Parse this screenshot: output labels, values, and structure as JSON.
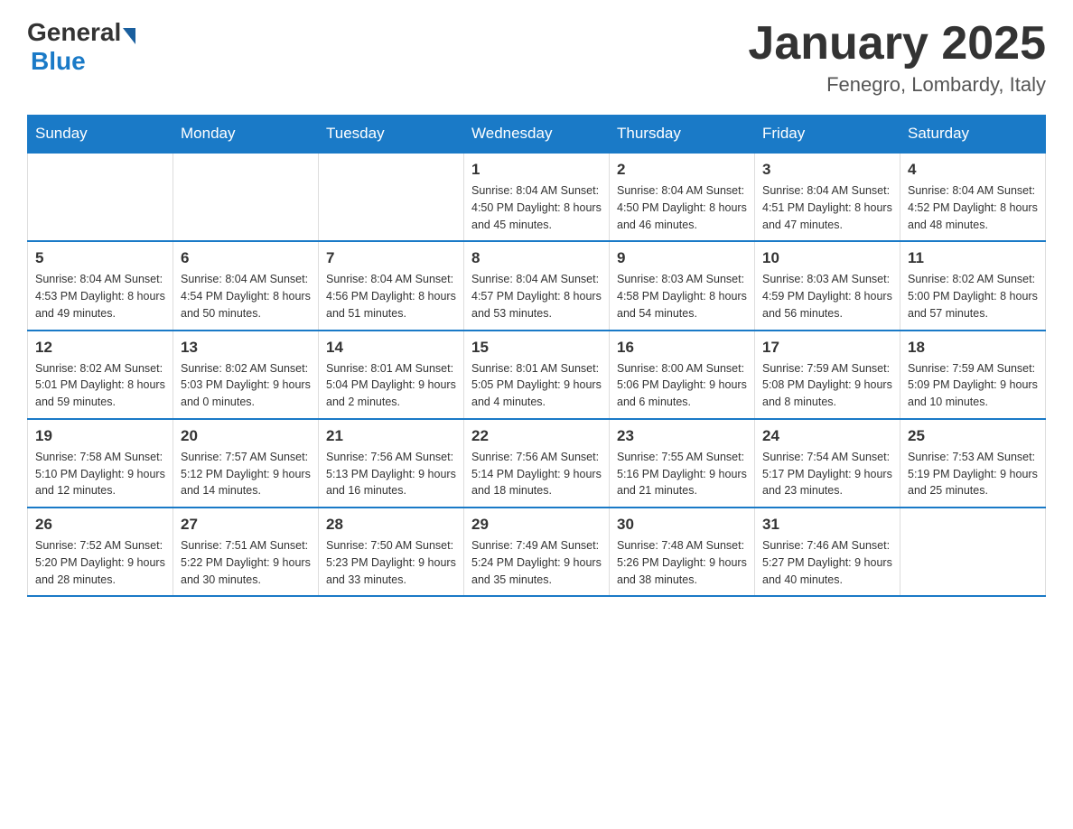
{
  "header": {
    "logo": {
      "general": "General",
      "blue": "Blue"
    },
    "title": "January 2025",
    "location": "Fenegro, Lombardy, Italy"
  },
  "days_of_week": [
    "Sunday",
    "Monday",
    "Tuesday",
    "Wednesday",
    "Thursday",
    "Friday",
    "Saturday"
  ],
  "weeks": [
    [
      {
        "day": "",
        "info": ""
      },
      {
        "day": "",
        "info": ""
      },
      {
        "day": "",
        "info": ""
      },
      {
        "day": "1",
        "info": "Sunrise: 8:04 AM\nSunset: 4:50 PM\nDaylight: 8 hours\nand 45 minutes."
      },
      {
        "day": "2",
        "info": "Sunrise: 8:04 AM\nSunset: 4:50 PM\nDaylight: 8 hours\nand 46 minutes."
      },
      {
        "day": "3",
        "info": "Sunrise: 8:04 AM\nSunset: 4:51 PM\nDaylight: 8 hours\nand 47 minutes."
      },
      {
        "day": "4",
        "info": "Sunrise: 8:04 AM\nSunset: 4:52 PM\nDaylight: 8 hours\nand 48 minutes."
      }
    ],
    [
      {
        "day": "5",
        "info": "Sunrise: 8:04 AM\nSunset: 4:53 PM\nDaylight: 8 hours\nand 49 minutes."
      },
      {
        "day": "6",
        "info": "Sunrise: 8:04 AM\nSunset: 4:54 PM\nDaylight: 8 hours\nand 50 minutes."
      },
      {
        "day": "7",
        "info": "Sunrise: 8:04 AM\nSunset: 4:56 PM\nDaylight: 8 hours\nand 51 minutes."
      },
      {
        "day": "8",
        "info": "Sunrise: 8:04 AM\nSunset: 4:57 PM\nDaylight: 8 hours\nand 53 minutes."
      },
      {
        "day": "9",
        "info": "Sunrise: 8:03 AM\nSunset: 4:58 PM\nDaylight: 8 hours\nand 54 minutes."
      },
      {
        "day": "10",
        "info": "Sunrise: 8:03 AM\nSunset: 4:59 PM\nDaylight: 8 hours\nand 56 minutes."
      },
      {
        "day": "11",
        "info": "Sunrise: 8:02 AM\nSunset: 5:00 PM\nDaylight: 8 hours\nand 57 minutes."
      }
    ],
    [
      {
        "day": "12",
        "info": "Sunrise: 8:02 AM\nSunset: 5:01 PM\nDaylight: 8 hours\nand 59 minutes."
      },
      {
        "day": "13",
        "info": "Sunrise: 8:02 AM\nSunset: 5:03 PM\nDaylight: 9 hours\nand 0 minutes."
      },
      {
        "day": "14",
        "info": "Sunrise: 8:01 AM\nSunset: 5:04 PM\nDaylight: 9 hours\nand 2 minutes."
      },
      {
        "day": "15",
        "info": "Sunrise: 8:01 AM\nSunset: 5:05 PM\nDaylight: 9 hours\nand 4 minutes."
      },
      {
        "day": "16",
        "info": "Sunrise: 8:00 AM\nSunset: 5:06 PM\nDaylight: 9 hours\nand 6 minutes."
      },
      {
        "day": "17",
        "info": "Sunrise: 7:59 AM\nSunset: 5:08 PM\nDaylight: 9 hours\nand 8 minutes."
      },
      {
        "day": "18",
        "info": "Sunrise: 7:59 AM\nSunset: 5:09 PM\nDaylight: 9 hours\nand 10 minutes."
      }
    ],
    [
      {
        "day": "19",
        "info": "Sunrise: 7:58 AM\nSunset: 5:10 PM\nDaylight: 9 hours\nand 12 minutes."
      },
      {
        "day": "20",
        "info": "Sunrise: 7:57 AM\nSunset: 5:12 PM\nDaylight: 9 hours\nand 14 minutes."
      },
      {
        "day": "21",
        "info": "Sunrise: 7:56 AM\nSunset: 5:13 PM\nDaylight: 9 hours\nand 16 minutes."
      },
      {
        "day": "22",
        "info": "Sunrise: 7:56 AM\nSunset: 5:14 PM\nDaylight: 9 hours\nand 18 minutes."
      },
      {
        "day": "23",
        "info": "Sunrise: 7:55 AM\nSunset: 5:16 PM\nDaylight: 9 hours\nand 21 minutes."
      },
      {
        "day": "24",
        "info": "Sunrise: 7:54 AM\nSunset: 5:17 PM\nDaylight: 9 hours\nand 23 minutes."
      },
      {
        "day": "25",
        "info": "Sunrise: 7:53 AM\nSunset: 5:19 PM\nDaylight: 9 hours\nand 25 minutes."
      }
    ],
    [
      {
        "day": "26",
        "info": "Sunrise: 7:52 AM\nSunset: 5:20 PM\nDaylight: 9 hours\nand 28 minutes."
      },
      {
        "day": "27",
        "info": "Sunrise: 7:51 AM\nSunset: 5:22 PM\nDaylight: 9 hours\nand 30 minutes."
      },
      {
        "day": "28",
        "info": "Sunrise: 7:50 AM\nSunset: 5:23 PM\nDaylight: 9 hours\nand 33 minutes."
      },
      {
        "day": "29",
        "info": "Sunrise: 7:49 AM\nSunset: 5:24 PM\nDaylight: 9 hours\nand 35 minutes."
      },
      {
        "day": "30",
        "info": "Sunrise: 7:48 AM\nSunset: 5:26 PM\nDaylight: 9 hours\nand 38 minutes."
      },
      {
        "day": "31",
        "info": "Sunrise: 7:46 AM\nSunset: 5:27 PM\nDaylight: 9 hours\nand 40 minutes."
      },
      {
        "day": "",
        "info": ""
      }
    ]
  ]
}
